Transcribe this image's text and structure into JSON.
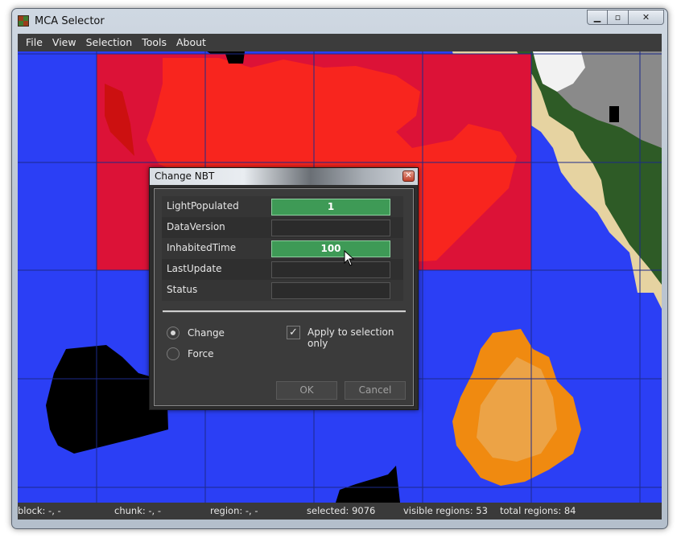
{
  "window": {
    "title": "MCA Selector",
    "app_icon": "grass-block-icon",
    "controls": {
      "minimize": "▁",
      "maximize": "▫",
      "close": "✕"
    }
  },
  "menu": {
    "items": [
      {
        "label": "File"
      },
      {
        "label": "View"
      },
      {
        "label": "Selection"
      },
      {
        "label": "Tools"
      },
      {
        "label": "About"
      }
    ]
  },
  "dialog": {
    "title": "Change NBT",
    "close_icon": "✕",
    "fields": [
      {
        "label": "LightPopulated",
        "value": "1",
        "filled": true
      },
      {
        "label": "DataVersion",
        "value": "",
        "filled": false
      },
      {
        "label": "InhabitedTime",
        "value": "100",
        "filled": true
      },
      {
        "label": "LastUpdate",
        "value": "",
        "filled": false
      },
      {
        "label": "Status",
        "value": "",
        "filled": false
      }
    ],
    "mode_change": "Change",
    "mode_force": "Force",
    "mode_selected": "Change",
    "apply_selection_only": "Apply to selection only",
    "apply_selection_checked": true,
    "ok_label": "OK",
    "cancel_label": "Cancel"
  },
  "status": {
    "block": "block: -, -",
    "chunk": "chunk: -, -",
    "region": "region: -, -",
    "selected": "selected: 9076",
    "visible_regions": "visible regions: 53",
    "total_regions": "total regions: 84"
  },
  "colors": {
    "ocean": "#2b3ff5",
    "selection": "#dc1237",
    "land_red": "#f8251e",
    "sand": "#e6d3a1",
    "forest": "#2e5b26",
    "stone": "#8a8a8a",
    "orange": "#f08a10",
    "void": "#000000",
    "accent_field": "#3e9a56",
    "grid": "#1c2a8a"
  }
}
